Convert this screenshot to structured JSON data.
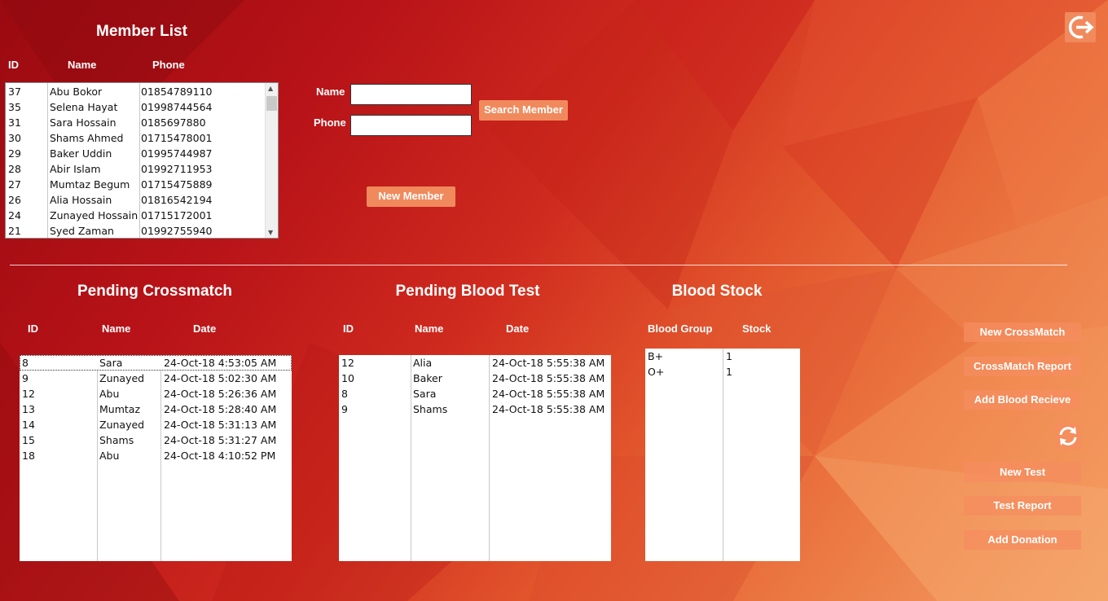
{
  "member_list": {
    "title": "Member List",
    "columns": [
      "ID",
      "Name",
      "Phone"
    ],
    "rows": [
      {
        "id": "37",
        "name": "Abu Bokor",
        "phone": "01854789110"
      },
      {
        "id": "35",
        "name": "Selena Hayat",
        "phone": "01998744564"
      },
      {
        "id": "31",
        "name": "Sara Hossain",
        "phone": "0185697880"
      },
      {
        "id": "30",
        "name": "Shams Ahmed",
        "phone": "01715478001"
      },
      {
        "id": "29",
        "name": "Baker Uddin",
        "phone": "01995744987"
      },
      {
        "id": "28",
        "name": "Abir Islam",
        "phone": "01992711953"
      },
      {
        "id": "27",
        "name": "Mumtaz Begum",
        "phone": "01715475889"
      },
      {
        "id": "26",
        "name": "Alia Hossain",
        "phone": "01816542194"
      },
      {
        "id": "24",
        "name": "Zunayed Hossain",
        "phone": "01715172001"
      },
      {
        "id": "21",
        "name": "Syed Zaman",
        "phone": "01992755940"
      }
    ]
  },
  "search": {
    "name_label": "Name",
    "phone_label": "Phone",
    "name_value": "",
    "phone_value": "",
    "search_button": "Search Member",
    "new_member_button": "New  Member"
  },
  "pending_crossmatch": {
    "title": "Pending Crossmatch",
    "columns": [
      "ID",
      "Name",
      "Date"
    ],
    "rows": [
      {
        "id": "8",
        "name": "Sara",
        "date": "24-Oct-18 4:53:05 AM"
      },
      {
        "id": "9",
        "name": "Zunayed",
        "date": "24-Oct-18 5:02:30 AM"
      },
      {
        "id": "12",
        "name": "Abu",
        "date": "24-Oct-18 5:26:36 AM"
      },
      {
        "id": "13",
        "name": "Mumtaz",
        "date": "24-Oct-18 5:28:40 AM"
      },
      {
        "id": "14",
        "name": "Zunayed",
        "date": "24-Oct-18 5:31:13 AM"
      },
      {
        "id": "15",
        "name": "Shams",
        "date": "24-Oct-18 5:31:27 AM"
      },
      {
        "id": "18",
        "name": "Abu",
        "date": "24-Oct-18 4:10:52 PM"
      }
    ]
  },
  "pending_blood_test": {
    "title": "Pending Blood Test",
    "columns": [
      "ID",
      "Name",
      "Date"
    ],
    "rows": [
      {
        "id": "12",
        "name": "Alia",
        "date": "24-Oct-18 5:55:38 AM"
      },
      {
        "id": "10",
        "name": "Baker",
        "date": "24-Oct-18 5:55:38 AM"
      },
      {
        "id": "8",
        "name": "Sara",
        "date": "24-Oct-18 5:55:38 AM"
      },
      {
        "id": "9",
        "name": "Shams",
        "date": "24-Oct-18 5:55:38 AM"
      }
    ]
  },
  "blood_stock": {
    "title": "Blood Stock",
    "columns": [
      "Blood Group",
      "Stock"
    ],
    "rows": [
      {
        "group": "B+",
        "stock": "1"
      },
      {
        "group": "O+",
        "stock": "1"
      }
    ]
  },
  "actions": {
    "new_crossmatch": "New CrossMatch",
    "crossmatch_report": "CrossMatch Report",
    "add_blood_recieve": "Add Blood Recieve",
    "new_test": "New  Test",
    "test_report": "Test Report",
    "add_donation": "Add Donation"
  },
  "icons": {
    "logout": "logout-icon",
    "refresh": "refresh-icon"
  },
  "colors": {
    "accent": "#f08a5d",
    "bg_dark": "#9a0a10",
    "bg_light": "#f4a36a"
  }
}
